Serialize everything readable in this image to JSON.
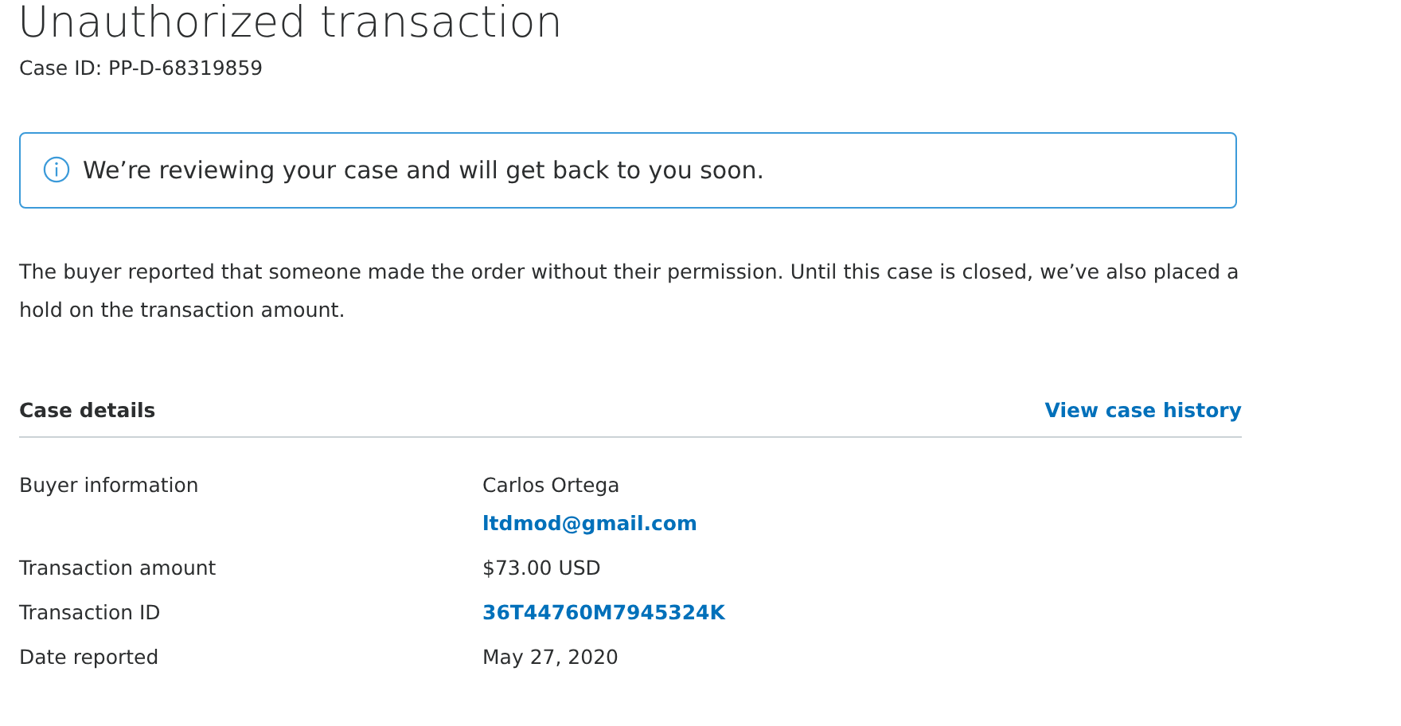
{
  "title": "Unauthorized transaction",
  "case_id": "Case ID: PP-D-68319859",
  "notice": {
    "text": "We’re reviewing your case and will get back to you soon."
  },
  "description": "The buyer reported that someone made the order without their permission. Until this case is closed, we’ve also placed a hold on the transaction amount.",
  "details": {
    "heading": "Case details",
    "history_link": "View case history",
    "rows": [
      {
        "label": "Buyer information",
        "values": [
          {
            "kind": "text",
            "text": "Carlos Ortega"
          },
          {
            "kind": "link",
            "text": "ltdmod@gmail.com"
          }
        ]
      },
      {
        "label": "Transaction amount",
        "values": [
          {
            "kind": "text",
            "text": "$73.00 USD"
          }
        ]
      },
      {
        "label": "Transaction ID",
        "values": [
          {
            "kind": "link",
            "text": "36T44760M7945324K"
          }
        ]
      },
      {
        "label": "Date reported",
        "values": [
          {
            "kind": "text",
            "text": "May 27, 2020"
          }
        ]
      }
    ]
  }
}
